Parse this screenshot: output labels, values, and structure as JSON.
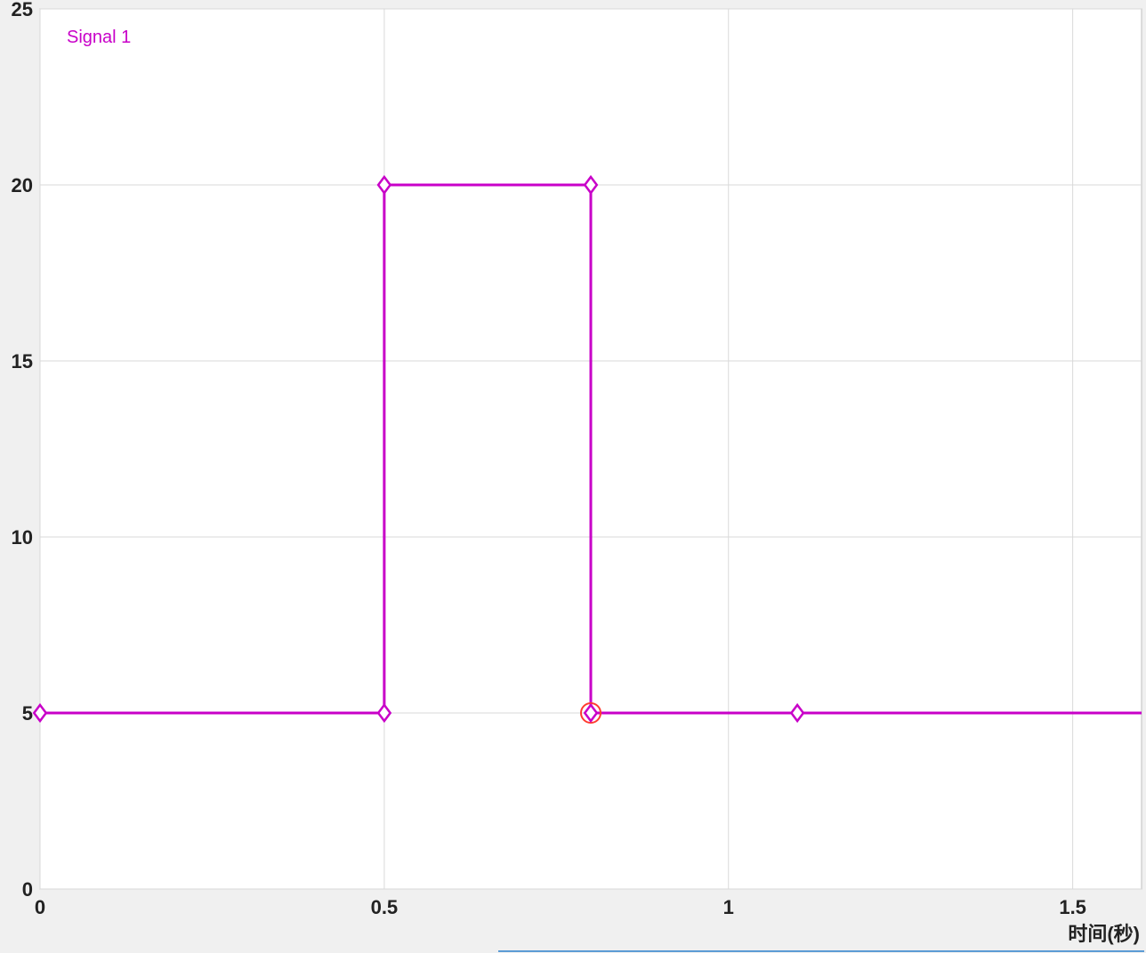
{
  "chart_data": {
    "type": "line",
    "xlabel": "时间(秒)",
    "ylabel": "",
    "title": "",
    "xlim": [
      0,
      1.6
    ],
    "ylim": [
      0,
      25
    ],
    "x_ticks": [
      0,
      0.5,
      1,
      1.5
    ],
    "y_ticks": [
      0,
      5,
      10,
      15,
      20,
      25
    ],
    "series": [
      {
        "name": "Signal 1",
        "color": "#c800c8",
        "x": [
          0,
          0.5,
          0.5,
          0.8,
          0.8,
          1.1
        ],
        "y": [
          5,
          5,
          20,
          20,
          5,
          5
        ],
        "selected_point": {
          "x": 0.8,
          "y": 5
        }
      }
    ],
    "legend": [
      "Signal 1"
    ],
    "legend_position": "top-left"
  },
  "axis": {
    "x_tick_labels": [
      "0",
      "0.5",
      "1",
      "1.5"
    ],
    "y_tick_labels": [
      "0",
      "5",
      "10",
      "15",
      "20",
      "25"
    ],
    "x_axis_title": "时间(秒)"
  },
  "legend_entry": "Signal 1"
}
